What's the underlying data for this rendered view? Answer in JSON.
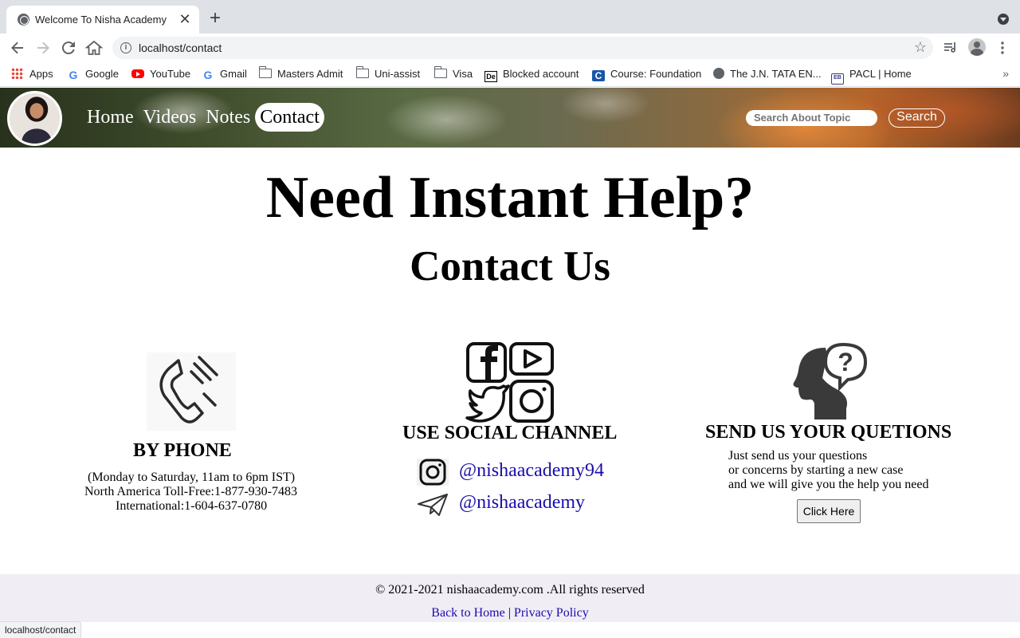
{
  "browser": {
    "tab_title": "Welcome To Nisha Academy",
    "tab_close": "✕",
    "new_tab": "+",
    "url": "localhost/contact",
    "status_url": "localhost/contact",
    "bookmarks": [
      {
        "label": "Apps",
        "icon": "apps-icon"
      },
      {
        "label": "Google",
        "icon": "google-icon"
      },
      {
        "label": "YouTube",
        "icon": "youtube-icon"
      },
      {
        "label": "Gmail",
        "icon": "google-icon"
      },
      {
        "label": "Masters Admit",
        "icon": "folder-icon"
      },
      {
        "label": "Uni-assist",
        "icon": "folder-icon"
      },
      {
        "label": "Visa",
        "icon": "folder-icon"
      },
      {
        "label": "Blocked account",
        "icon": "de-icon"
      },
      {
        "label": "Course: Foundation",
        "icon": "coursera-icon"
      },
      {
        "label": "The J.N. TATA EN...",
        "icon": "globe-icon"
      },
      {
        "label": "PACL | Home",
        "icon": "pacl-icon"
      }
    ]
  },
  "site": {
    "nav": [
      {
        "label": "Home",
        "active": false
      },
      {
        "label": "Videos",
        "active": false
      },
      {
        "label": "Notes",
        "active": false
      },
      {
        "label": "Contact",
        "active": true
      }
    ],
    "search_placeholder": "Search About Topic",
    "search_button": "Search"
  },
  "hero": {
    "title": "Need Instant Help?",
    "subtitle": "Contact Us"
  },
  "phone": {
    "title": "BY PHONE",
    "hours": "(Monday to Saturday, 11am to 6pm IST)",
    "toll_free": "North America Toll-Free:1-877-930-7483",
    "international": "International:1-604-637-0780"
  },
  "social": {
    "title": "USE SOCIAL CHANNEL",
    "instagram": "@nishaacademy94",
    "telegram": "@nishaacademy"
  },
  "questions": {
    "title": "SEND US YOUR QUETIONS",
    "line1": "Just send us your questions",
    "line2": "or concerns by starting a new case",
    "line3": "and we will give you the help you need",
    "button": "Click Here"
  },
  "footer": {
    "copyright": "© 2021-2021 nishaacademy.com .All rights reserved",
    "back_home": "Back to Home",
    "separator": " | ",
    "privacy": "Privacy Policy"
  }
}
